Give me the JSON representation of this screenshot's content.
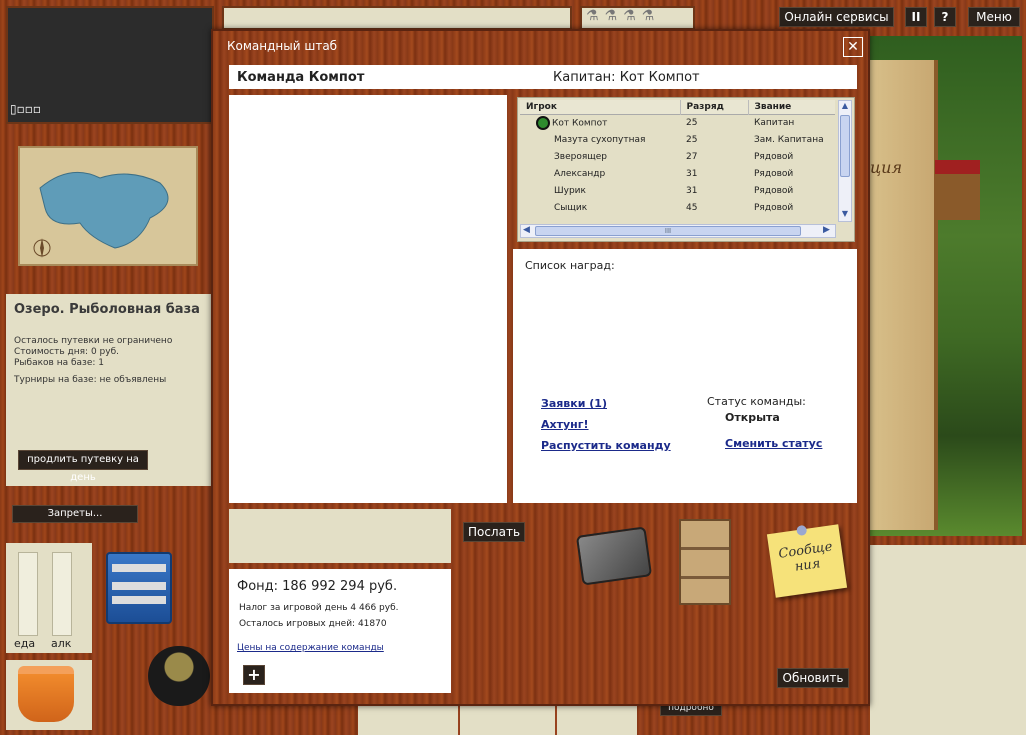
{
  "top_bar": {
    "online_services": "Онлайн сервисы",
    "pause": "II",
    "help": "?",
    "menu": "Меню"
  },
  "left": {
    "battery": "▯▫▫▫",
    "location_title": "Озеро. Рыболовная база",
    "info_lines": [
      "Осталось путевки не ограничено",
      "Стоимость дня: 0 руб.",
      "Рыбаков на базе: 1"
    ],
    "tournaments": "Турниры на базе: не объявлены",
    "extend_button": "продлить путевку на день",
    "bans_button": "Запреты...",
    "meter_food": "еда",
    "meter_alc": "алк",
    "details_button": "подробно"
  },
  "dialog": {
    "title": "Командный штаб",
    "team_name": "Команда Компот",
    "captain": "Капитан: Кот Компот",
    "table": {
      "headers": [
        "Игрок",
        "Разряд",
        "Звание"
      ],
      "rows": [
        {
          "player": "Кот Компот",
          "rank": "25",
          "title": "Капитан"
        },
        {
          "player": "Мазута сухопутная",
          "rank": "25",
          "title": "Зам. Капитана"
        },
        {
          "player": "Звероящер",
          "rank": "27",
          "title": "Рядовой"
        },
        {
          "player": "Александр",
          "rank": "31",
          "title": "Рядовой"
        },
        {
          "player": "Шурик",
          "rank": "31",
          "title": "Рядовой"
        },
        {
          "player": "Сыщик",
          "rank": "45",
          "title": "Рядовой"
        }
      ],
      "scroll_grip": "III"
    },
    "awards_label": "Список наград:",
    "links": {
      "requests": "Заявки (1)",
      "achtung": "Ахтунг!",
      "disband": "Распустить команду",
      "change_status": "Сменить статус"
    },
    "status_label": "Статус команды:",
    "status_value": "Открыта",
    "send_button": "Послать",
    "fund": "Фонд: 186 992 294 руб.",
    "tax": "Налог за игровой день 4 466 руб.",
    "days_left": "Осталось игровых дней: 41870",
    "prices_link": "Цены на содержание команды",
    "plus": "+",
    "note_text": "Сообще ния",
    "refresh_button": "Обновить",
    "close": "✕"
  },
  "colors": {
    "accent_link": "#1b2a8a",
    "panel": "#e3dfc6",
    "wood": "#9a4420"
  }
}
